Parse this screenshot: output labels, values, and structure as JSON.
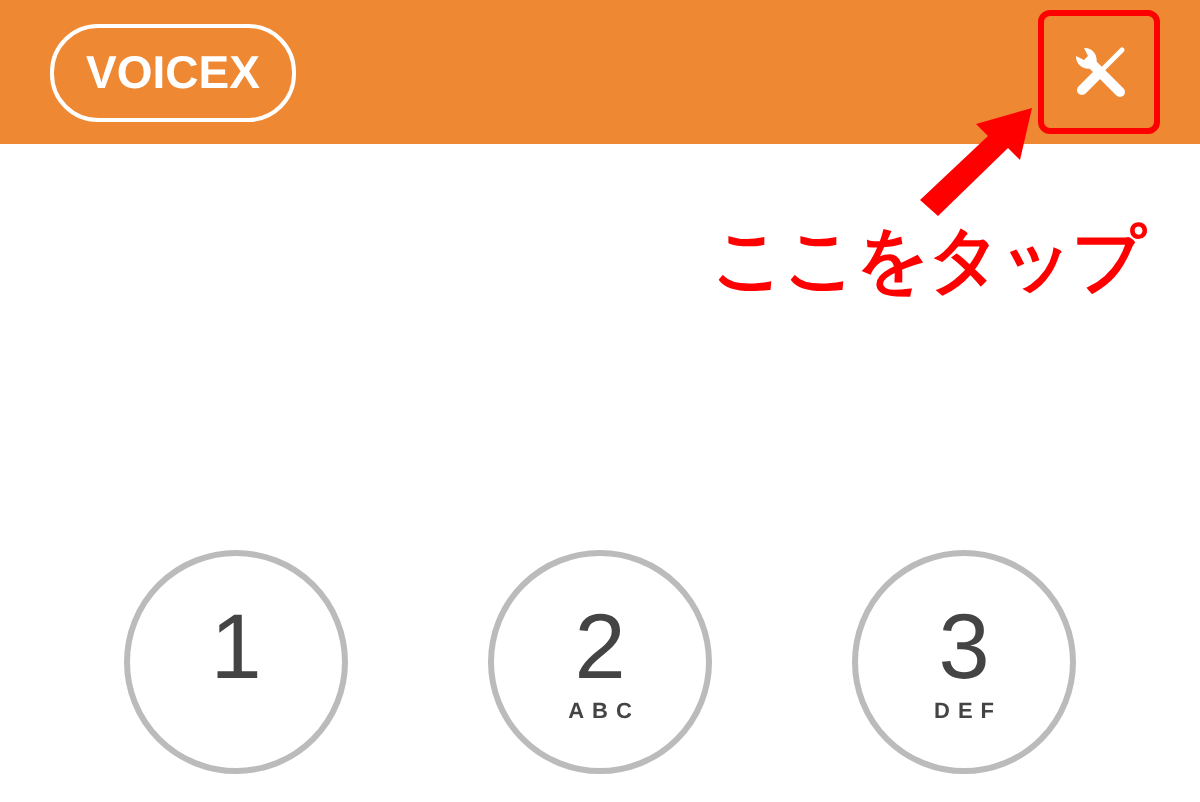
{
  "header": {
    "logo": "VOICEX",
    "settings_highlighted": true
  },
  "annotation": {
    "text": "ここをタップ"
  },
  "keypad": [
    {
      "digit": "1"
    },
    {
      "digit": "2",
      "letters": "ABC"
    },
    {
      "digit": "3",
      "letters": "DEF"
    }
  ]
}
